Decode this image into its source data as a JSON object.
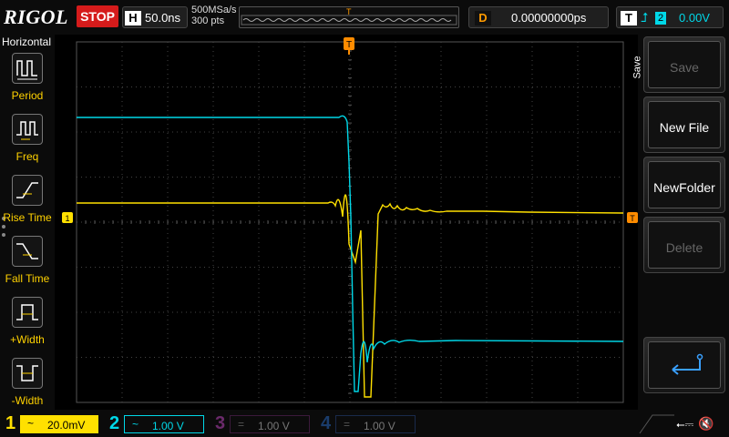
{
  "top": {
    "logo": "RIGOL",
    "run_state": "STOP",
    "timebase_key": "H",
    "timebase": "50.0ns",
    "sample_rate": "500MSa/s",
    "memory_depth": "300 pts",
    "trigger_marker": "T",
    "delay_key": "D",
    "delay": "0.00000000ps",
    "trigger_key": "T",
    "trigger_source": "2",
    "trigger_level": "0.00V"
  },
  "horizontal_menu": {
    "title": "Horizontal",
    "items": [
      {
        "label": "Period",
        "icon": "period-icon"
      },
      {
        "label": "Freq",
        "icon": "frequency-icon"
      },
      {
        "label": "Rise Time",
        "icon": "rise-time-icon"
      },
      {
        "label": "Fall Time",
        "icon": "fall-time-icon"
      },
      {
        "label": "+Width",
        "icon": "positive-width-icon"
      },
      {
        "label": "-Width",
        "icon": "negative-width-icon"
      }
    ]
  },
  "screen": {
    "ch1_marker": "1",
    "trigger_marker": "T",
    "trigger_level_marker": "T"
  },
  "save_menu": {
    "caption": "Save",
    "buttons": [
      {
        "label": "Save",
        "enabled": false
      },
      {
        "label": "New File",
        "enabled": true
      },
      {
        "label": "NewFolder",
        "enabled": true
      },
      {
        "label": "Delete",
        "enabled": false
      }
    ],
    "return_icon": "return-arrow-icon"
  },
  "channels": [
    {
      "num": "1",
      "coupling": "~",
      "scale": "20.0mV",
      "color": "#ffe000",
      "active": true
    },
    {
      "num": "2",
      "coupling": "~",
      "scale": "1.00 V",
      "color": "#00d8e8",
      "active": true
    },
    {
      "num": "3",
      "coupling": "=",
      "scale": "1.00 V",
      "color": "#c000c0",
      "active": false
    },
    {
      "num": "4",
      "coupling": "=",
      "scale": "1.00 V",
      "color": "#0070ff",
      "active": false
    }
  ],
  "status_icons": {
    "usb": "usb-icon",
    "sound": "speaker-mute-icon"
  },
  "colors": {
    "ch1": "#ffe000",
    "ch2": "#00d8e8",
    "trigger": "#ff8c00",
    "stop": "#d51b1b"
  }
}
